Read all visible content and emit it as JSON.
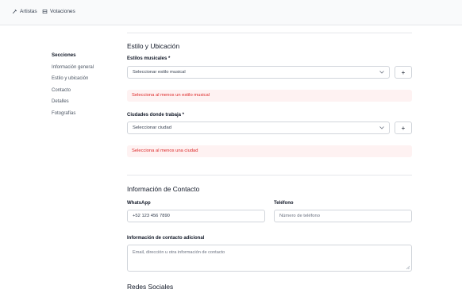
{
  "topbar": {
    "links": [
      {
        "label": "Artistas",
        "icon": "brush-icon"
      },
      {
        "label": "Votaciones",
        "icon": "ballot-icon"
      }
    ]
  },
  "sidebar": {
    "title": "Secciones",
    "items": [
      {
        "label": "Información general"
      },
      {
        "label": "Estilo y ubicación"
      },
      {
        "label": "Contacto"
      },
      {
        "label": "Detalles"
      },
      {
        "label": "Fotografías"
      }
    ]
  },
  "style_section": {
    "title": "Estilo y Ubicación",
    "styles_label": "Estilos musicales *",
    "styles_select": "Seleccionar estilo musical",
    "styles_error": "Selecciona al menos un estilo musical",
    "cities_label": "Ciudades donde trabaja *",
    "cities_select": "Seleccionar ciudad",
    "cities_error": "Selecciona al menos una ciudad",
    "add_label": "+"
  },
  "contact_section": {
    "title": "Información de Contacto",
    "whatsapp_label": "WhatsApp",
    "whatsapp_value": "+52 123 456 7890",
    "phone_label": "Teléfono",
    "phone_placeholder": "Número de teléfono",
    "extra_label": "Información de contacto adicional",
    "extra_placeholder": "Email, dirección u otra información de contacto"
  },
  "social_section": {
    "title": "Redes Sociales"
  },
  "colors": {
    "error_bg": "#fef2f2",
    "error_text": "#dc2626",
    "border": "#d1d5db"
  }
}
